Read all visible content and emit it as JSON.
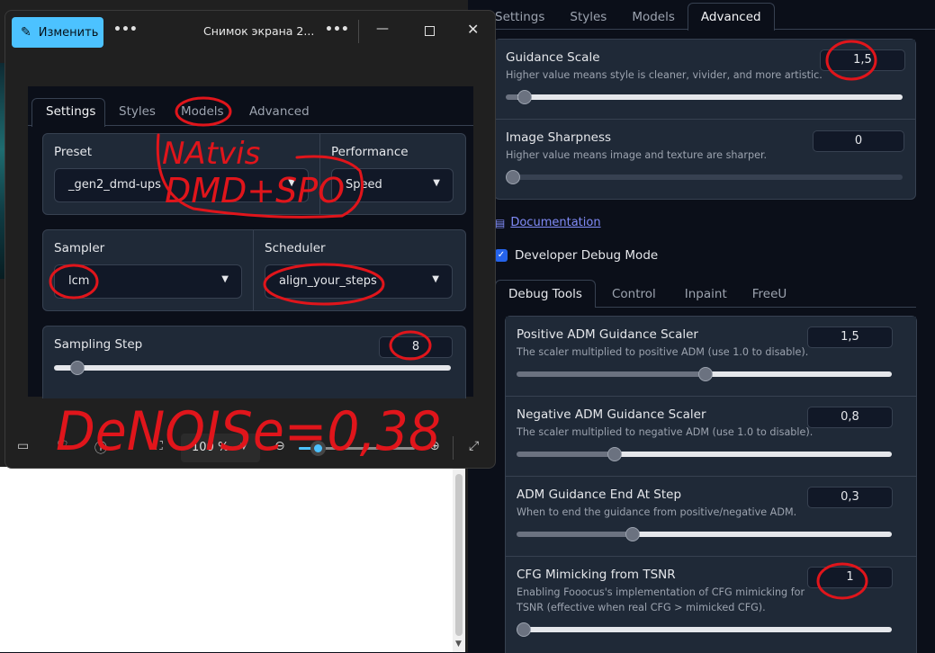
{
  "viewer": {
    "edit_label": "Изменить",
    "title": "Снимок экрана 2...",
    "zoom": "100 %",
    "zoom_level": 0.1
  },
  "left_panel": {
    "tabs": [
      "Settings",
      "Styles",
      "Models",
      "Advanced"
    ],
    "preset_label": "Preset",
    "preset_value": "_gen2_dmd-ups",
    "performance_label": "Performance",
    "performance_value": "Speed",
    "sampler_label": "Sampler",
    "sampler_value": "lcm",
    "scheduler_label": "Scheduler",
    "scheduler_value": "align_your_steps",
    "sampling_step_label": "Sampling Step",
    "sampling_step_value": "8"
  },
  "annotations": {
    "natvis": "NAtvis",
    "dmd_spo": "DMD+SPO",
    "denoise": "DeNOISe=0,38"
  },
  "right_panel": {
    "tabs": [
      "Settings",
      "Styles",
      "Models",
      "Advanced"
    ],
    "guidance_scale": {
      "label": "Guidance Scale",
      "desc": "Higher value means style is cleaner, vivider, and more artistic.",
      "value": "1,5",
      "level": 0.03
    },
    "image_sharpness": {
      "label": "Image Sharpness",
      "desc": "Higher value means image and texture are sharper.",
      "value": "0",
      "level": 0.0
    },
    "documentation": "Documentation",
    "debug_mode": "Developer Debug Mode",
    "debug_tabs": [
      "Debug Tools",
      "Control",
      "Inpaint",
      "FreeU"
    ],
    "pos_adm": {
      "label": "Positive ADM Guidance Scaler",
      "desc": "The scaler multiplied to positive ADM (use 1.0 to disable).",
      "value": "1,5",
      "level": 0.5
    },
    "neg_adm": {
      "label": "Negative ADM Guidance Scaler",
      "desc": "The scaler multiplied to negative ADM (use 1.0 to disable).",
      "value": "0,8",
      "level": 0.25
    },
    "adm_end": {
      "label": "ADM Guidance End At Step",
      "desc": "When to end the guidance from positive/negative ADM.",
      "value": "0,3",
      "level": 0.3
    },
    "cfg_mimic": {
      "label": "CFG Mimicking from TSNR",
      "desc": "Enabling Fooocus's implementation of CFG mimicking for TSNR (effective when real CFG > mimicked CFG).",
      "value": "1",
      "level": 0.0
    }
  },
  "colors": {
    "accent": "#4cc2ff",
    "annotation": "#e0151b",
    "checkbox": "#2563eb"
  }
}
